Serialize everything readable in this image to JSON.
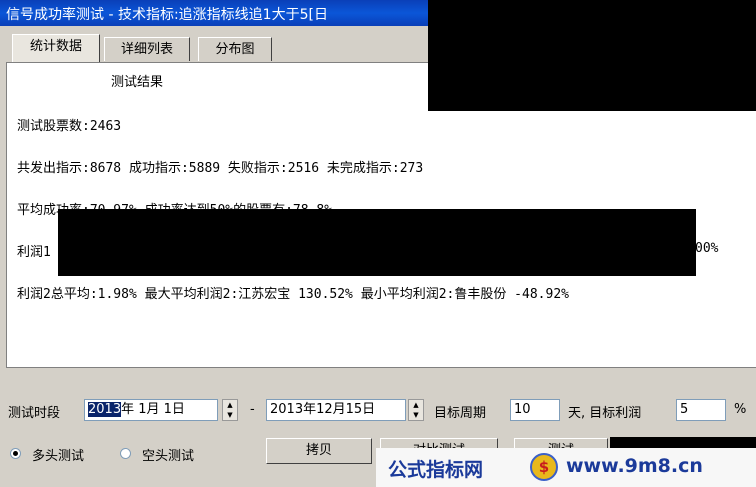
{
  "window": {
    "title": "信号成功率测试 - 技术指标:追涨指标线追1大于5[日"
  },
  "tabs": [
    {
      "label": "统计数据",
      "active": true
    },
    {
      "label": "详细列表",
      "active": false
    },
    {
      "label": "分布图",
      "active": false
    }
  ],
  "results": {
    "heading": "测试结果",
    "stock_count": "测试股票数:2463",
    "signals": "共发出指示:8678 成功指示:5889 失败指示:2516 未完成指示:273",
    "avg_success": "平均成功率:70.97% 成功率达到50%的股票有:78.8%",
    "profit1_start": "利润1",
    "profit1_tail": "00%",
    "profit2": "利润2总平均:1.98% 最大平均利润2:江苏宏宝 130.52% 最小平均利润2:鲁丰股份 -48.92%"
  },
  "controls": {
    "period_label": "测试时段",
    "start_year": "2013",
    "start_rest": "年  1月  1日",
    "dash": "-",
    "end_date": "2013年12月15日",
    "target_period_label": "目标周期",
    "target_period_value": "10",
    "days_label": "天, 目标利润",
    "target_profit_value": "5",
    "percent": "%",
    "long_test": "多头测试",
    "short_test": "空头测试",
    "copy_button": "拷贝",
    "compare_button": "对比测试",
    "test_button": "测试"
  },
  "watermark": {
    "left_text": "公式指标网",
    "logo_char": "$",
    "right_text": "www.9m8.cn"
  },
  "colors": {
    "title_bar": "#0b4fd0",
    "selection": "#0a246a",
    "watermark_text": "#1b3a9a"
  }
}
